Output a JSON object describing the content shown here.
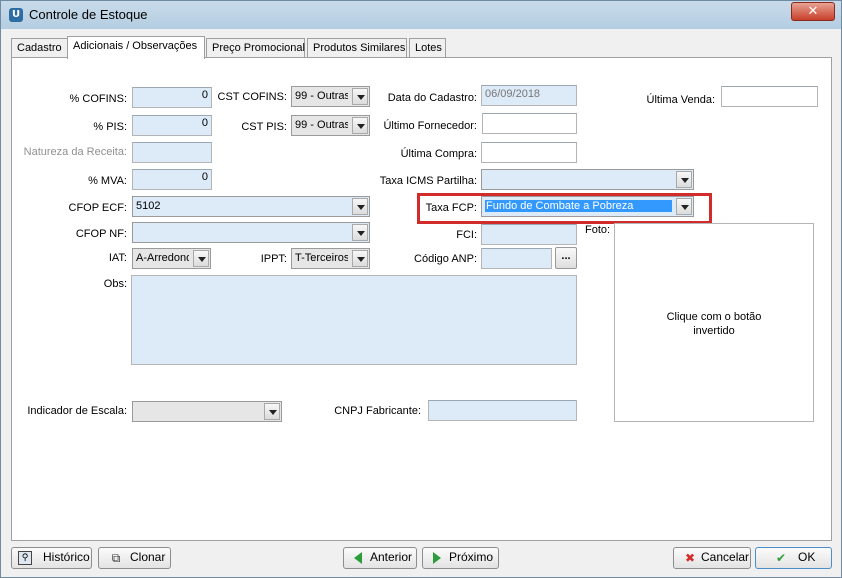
{
  "window": {
    "title": "Controle de Estoque",
    "close_label": "✕"
  },
  "tabs": [
    {
      "label": "Cadastro"
    },
    {
      "label": "Adicionais / Observações"
    },
    {
      "label": "Preço Promocional"
    },
    {
      "label": "Produtos Similares"
    },
    {
      "label": "Lotes"
    }
  ],
  "form": {
    "cofins": {
      "label": "% COFINS:",
      "value": "0"
    },
    "pis": {
      "label": "% PIS:",
      "value": "0"
    },
    "natureza": {
      "label": "Natureza da Receita:",
      "value": ""
    },
    "mva": {
      "label": "% MVA:",
      "value": "0"
    },
    "cst_cofins": {
      "label": "CST COFINS:",
      "value": "99 - Outras"
    },
    "cst_pis": {
      "label": "CST PIS:",
      "value": "99 - Outras"
    },
    "cfop_ecf": {
      "label": "CFOP ECF:",
      "value": "5102"
    },
    "cfop_nf": {
      "label": "CFOP NF:",
      "value": ""
    },
    "iat": {
      "label": "IAT:",
      "value": "A-Arredondamento"
    },
    "ippt": {
      "label": "IPPT:",
      "value": "T-Terceiros"
    },
    "obs": {
      "label": "Obs:"
    },
    "data_cadastro": {
      "label": "Data do Cadastro:",
      "value": "06/09/2018"
    },
    "ultimo_fornecedor": {
      "label": "Último Fornecedor:",
      "value": ""
    },
    "ultima_compra": {
      "label": "Última Compra:",
      "value": ""
    },
    "taxa_icms": {
      "label": "Taxa ICMS Partilha:",
      "value": ""
    },
    "taxa_fcp": {
      "label": "Taxa FCP:",
      "value": "Fundo de Combate a Pobreza"
    },
    "fci": {
      "label": "FCI:",
      "value": ""
    },
    "codigo_anp": {
      "label": "Código ANP:",
      "value": "",
      "button": "..."
    },
    "ultima_venda": {
      "label": "Última Venda:",
      "value": ""
    },
    "foto": {
      "label": "Foto:",
      "hint": "Clique com o botão invertido"
    },
    "indicador_escala": {
      "label": "Indicador de Escala:",
      "value": ""
    },
    "cnpj_fabricante": {
      "label": "CNPJ Fabricante:",
      "value": ""
    }
  },
  "buttons": {
    "historico": "Histórico",
    "clonar": "Clonar",
    "anterior": "Anterior",
    "proximo": "Próximo",
    "cancelar": "Cancelar",
    "ok": "OK"
  },
  "icons": {
    "historico": "magnifier-icon",
    "clonar": "clone-icon",
    "anterior": "arrow-left-icon",
    "proximo": "arrow-right-icon",
    "cancelar": "x-icon",
    "ok": "check-icon"
  },
  "colors": {
    "field_bg": "#ddeaf7",
    "selection": "#3399ff",
    "highlight_border": "#d12b2b",
    "cancel_icon": "#d42a2a",
    "ok_icon": "#2d9c3a"
  }
}
